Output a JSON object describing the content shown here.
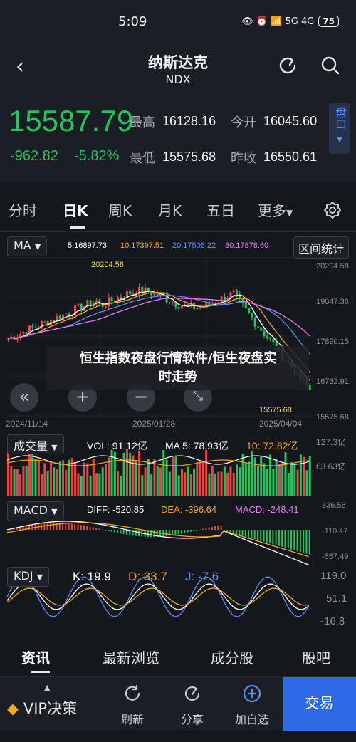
{
  "status": {
    "time": "5:09",
    "icons": "👁 ⏰ 📶 5G 4G",
    "battery": "75"
  },
  "header": {
    "title": "纳斯达克",
    "subtitle": "NDX"
  },
  "quote": {
    "price": "15587.79",
    "change": "-962.82",
    "pct": "-5.82%",
    "high_label": "最高",
    "high": "16128.16",
    "open_label": "今开",
    "open": "16045.60",
    "low_label": "最低",
    "low": "15575.68",
    "prev_label": "昨收",
    "prev": "16550.61",
    "panel_label": "盘口"
  },
  "tabs": [
    "分时",
    "日K",
    "周K",
    "月K",
    "五日",
    "更多"
  ],
  "main": {
    "indicator": "MA",
    "ma5": "5:16897.73",
    "ma10": "10:17397.51",
    "ma20": "20:17506.22",
    "ma30": "30:17878.60",
    "range_btn": "区间统计",
    "axis": [
      "20204.58",
      "19047.36",
      "17890.15",
      "16732.91",
      "15575.68"
    ],
    "high_mark": "20204.58",
    "low_mark": "15575.68",
    "dates": [
      "2024/11/14",
      "2025/01/28",
      "2025/04/04"
    ]
  },
  "volume": {
    "indicator": "成交量",
    "vol": "VOL: 91.12亿",
    "ma5": "MA 5: 78.93亿",
    "ma10": "10: 72.82亿",
    "axis": [
      "127.3亿",
      "63.63亿"
    ]
  },
  "macd": {
    "indicator": "MACD",
    "diff": "DIFF: -520.85",
    "dea": "DEA: -396.64",
    "macd": "MACD: -248.41",
    "axis": [
      "336.56",
      "-110.47",
      "-557.49"
    ]
  },
  "kdj": {
    "indicator": "KDJ",
    "k": "K: 19.9",
    "d": "D: 33.7",
    "j": "J: -7.6",
    "axis": [
      "119.0",
      "51.1",
      "-16.8"
    ]
  },
  "overlay": {
    "line1": "恒生指数夜盘行情软件/恒生夜盘实",
    "line2": "时走势"
  },
  "bottom_tabs": [
    "资讯",
    "最新浏览",
    "成分股",
    "股吧"
  ],
  "toolbar": {
    "vip": "VIP决策",
    "refresh": "刷新",
    "share": "分享",
    "watch": "加自选",
    "trade": "交易"
  },
  "colors": {
    "up": "#ef4444",
    "down": "#22c55e",
    "accent": "#2c6be5",
    "ma5": "#ffffff",
    "ma10": "#f5a524",
    "ma20": "#5b8ef2",
    "ma30": "#e879f9"
  }
}
